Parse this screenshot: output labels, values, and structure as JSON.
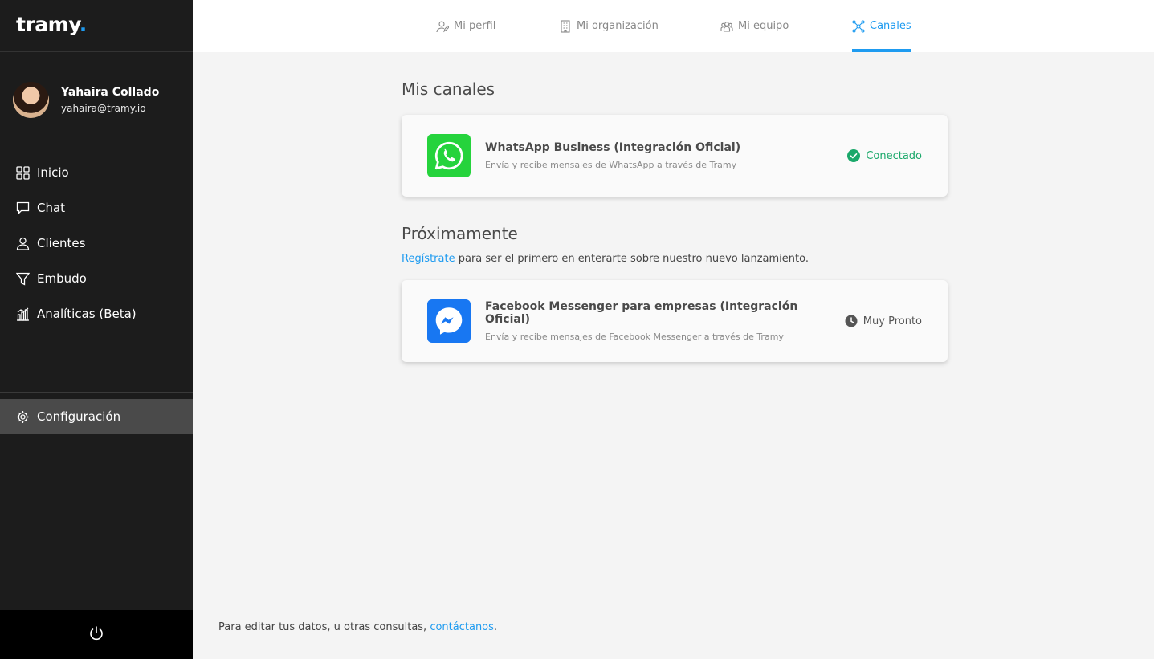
{
  "app": {
    "logo_text": "tramy",
    "logo_dot": "."
  },
  "user": {
    "name": "Yahaira Collado",
    "email": "yahaira@tramy.io"
  },
  "sidebar": {
    "items": [
      {
        "label": "Inicio",
        "icon": "grid-icon"
      },
      {
        "label": "Chat",
        "icon": "chat-icon"
      },
      {
        "label": "Clientes",
        "icon": "user-icon"
      },
      {
        "label": "Embudo",
        "icon": "funnel-icon"
      },
      {
        "label": "Analíticas (Beta)",
        "icon": "analytics-icon"
      }
    ],
    "config_label": "Configuración"
  },
  "tabs": [
    {
      "label": "Mi perfil",
      "icon": "profile-icon"
    },
    {
      "label": "Mi organización",
      "icon": "building-icon"
    },
    {
      "label": "Mi equipo",
      "icon": "team-icon"
    },
    {
      "label": "Canales",
      "icon": "network-icon",
      "active": true
    }
  ],
  "channels": {
    "title": "Mis canales",
    "whatsapp": {
      "title": "WhatsApp Business (Integración Oficial)",
      "description": "Envía y recibe mensajes de WhatsApp a través de Tramy",
      "status": "Conectado"
    }
  },
  "upcoming": {
    "title": "Próximamente",
    "link": "Regístrate",
    "text": " para ser el primero en enterarte sobre nuestro nuevo lanzamiento.",
    "messenger": {
      "title": "Facebook Messenger para empresas (Integración Oficial)",
      "description": "Envía y recibe mensajes de Facebook Messenger a través de Tramy",
      "status": "Muy Pronto"
    }
  },
  "footer": {
    "text": "Para editar tus datos, u otras consultas, ",
    "link": "contáctanos",
    "period": "."
  },
  "colors": {
    "accent": "#1e9bf0",
    "sidebar_bg": "#1c1c1c",
    "success": "#1aa86a",
    "whatsapp": "#25d33c",
    "messenger": "#1877f2"
  }
}
